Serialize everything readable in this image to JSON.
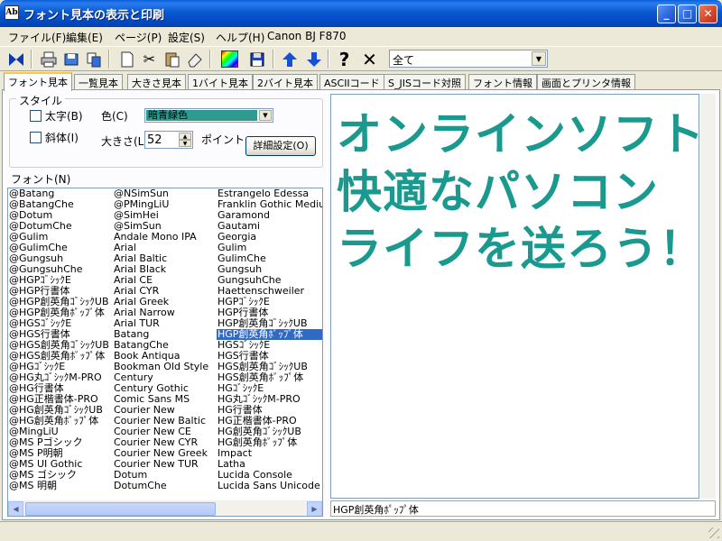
{
  "window": {
    "title": "フォント見本の表示と印刷",
    "icon_text": "Ab",
    "minimize": "_",
    "maximize": "□",
    "close": "✕"
  },
  "menu": [
    "ファイル(F)",
    "編集(E)",
    "ページ(P)",
    "設定(S)",
    "ヘルプ(H)",
    "Canon BJ F870"
  ],
  "toolbar": {
    "icons": [
      "bowtie-icon",
      "printer-icon",
      "save-icon",
      "copy-icon",
      "new-page-icon",
      "cut-icon",
      "paste-icon",
      "eraser-icon",
      "color-palette-icon",
      "floppy-icon",
      "arrow-up-icon",
      "arrow-down-icon",
      "help-icon",
      "close-icon"
    ],
    "filter_value": "全て"
  },
  "tabs": [
    "フォント見本",
    "一覧見本",
    "大きさ見本",
    "1バイト見本",
    "2バイト見本",
    "ASCIIコード",
    "S_JISコード対照",
    "フォント情報",
    "画面とプリンタ情報"
  ],
  "style": {
    "group_label": "スタイル",
    "bold_label": "太字(B)",
    "italic_label": "斜体(I)",
    "color_label": "色(C)",
    "color_value": "暗青緑色",
    "size_label": "大きさ(L)",
    "size_value": "52",
    "point_label": "ポイント",
    "detail_button": "詳細設定(O)"
  },
  "font_list": {
    "label": "フォント(N)",
    "selected": "HGP創英角ﾎﾟｯﾌﾟ体",
    "columns": [
      [
        "@Batang",
        "@BatangChe",
        "@Dotum",
        "@DotumChe",
        "@Gulim",
        "@GulimChe",
        "@Gungsuh",
        "@GungsuhChe",
        "@HGPｺﾞｼｯｸE",
        "@HGP行書体",
        "@HGP創英角ｺﾞｼｯｸUB",
        "@HGP創英角ﾎﾟｯﾌﾟ体",
        "@HGSｺﾞｼｯｸE",
        "@HGS行書体",
        "@HGS創英角ｺﾞｼｯｸUB",
        "@HGS創英角ﾎﾟｯﾌﾟ体",
        "@HGｺﾞｼｯｸE",
        "@HG丸ｺﾞｼｯｸM-PRO",
        "@HG行書体",
        "@HG正楷書体-PRO",
        "@HG創英角ｺﾞｼｯｸUB",
        "@HG創英角ﾎﾟｯﾌﾟ体",
        "@MingLiU",
        "@MS Pゴシック",
        "@MS P明朝",
        "@MS UI Gothic",
        "@MS ゴシック",
        "@MS 明朝"
      ],
      [
        "@NSimSun",
        "@PMingLiU",
        "@SimHei",
        "@SimSun",
        "Andale Mono IPA",
        "Arial",
        "Arial Baltic",
        "Arial Black",
        "Arial CE",
        "Arial CYR",
        "Arial Greek",
        "Arial Narrow",
        "Arial TUR",
        "Batang",
        "BatangChe",
        "Book Antiqua",
        "Bookman Old Style",
        "Century",
        "Century Gothic",
        "Comic Sans MS",
        "Courier New",
        "Courier New Baltic",
        "Courier New CE",
        "Courier New CYR",
        "Courier New Greek",
        "Courier New TUR",
        "Dotum",
        "DotumChe"
      ],
      [
        "Estrangelo Edessa",
        "Franklin Gothic Mediu",
        "Garamond",
        "Gautami",
        "Georgia",
        "Gulim",
        "GulimChe",
        "Gungsuh",
        "GungsuhChe",
        "Haettenschweiler",
        "HGPｺﾞｼｯｸE",
        "HGP行書体",
        "HGP創英角ｺﾞｼｯｸUB",
        "HGP創英角ﾎﾟｯﾌﾟ体",
        "HGSｺﾞｼｯｸE",
        "HGS行書体",
        "HGS創英角ｺﾞｼｯｸUB",
        "HGS創英角ﾎﾟｯﾌﾟ体",
        "HGｺﾞｼｯｸE",
        "HG丸ｺﾞｼｯｸM-PRO",
        "HG行書体",
        "HG正楷書体-PRO",
        "HG創英角ｺﾞｼｯｸUB",
        "HG創英角ﾎﾟｯﾌﾟ体",
        "Impact",
        "Latha",
        "Lucida Console",
        "Lucida Sans Unicode"
      ]
    ]
  },
  "sample": {
    "lines": [
      "オンラインソフトで",
      "快適なパソコン",
      "ライフを送ろう！"
    ],
    "color": "#1a9a8f"
  },
  "sample_font_name": "HGP創英角ﾎﾟｯﾌﾟ体"
}
